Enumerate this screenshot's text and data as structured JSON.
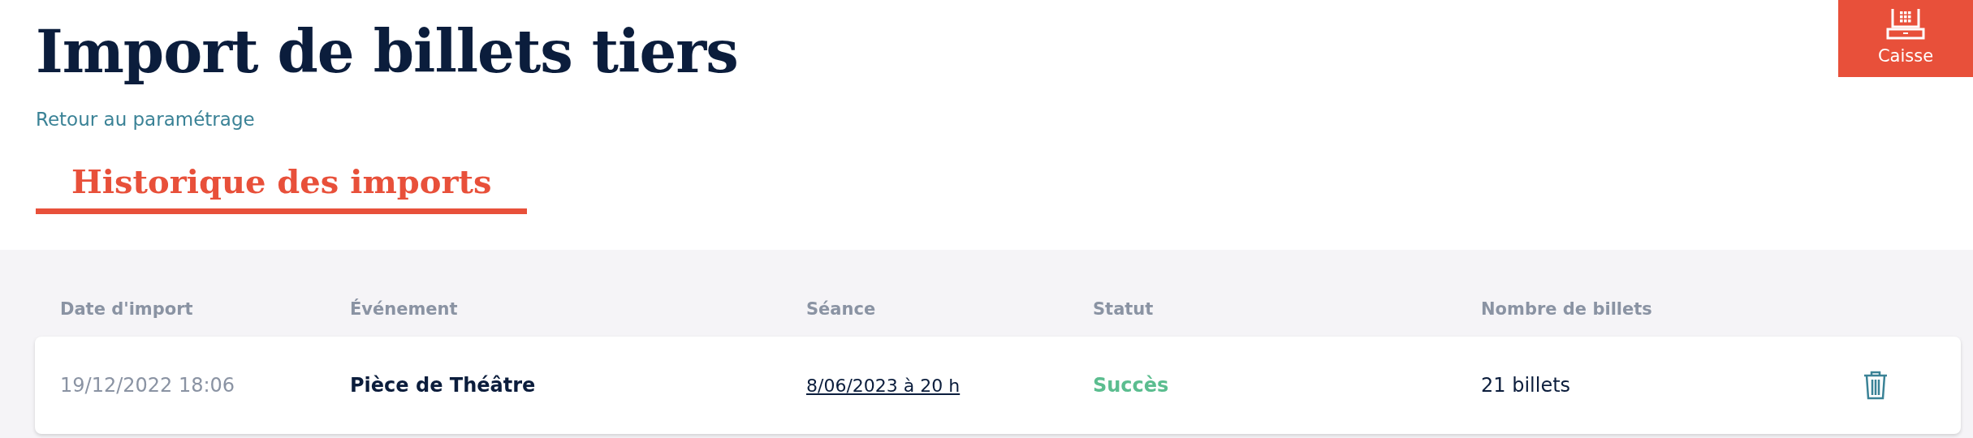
{
  "title": "Import de billets tiers",
  "back_link": "Retour au paramétrage",
  "cash_button": {
    "label": "Caisse"
  },
  "tabs": [
    {
      "label": "Historique des imports",
      "selected": true
    }
  ],
  "table": {
    "columns": [
      "Date d'import",
      "Événement",
      "Séance",
      "Statut",
      "Nombre de billets"
    ],
    "rows": [
      {
        "date": "19/12/2022 18:06",
        "event": "Pièce de Théâtre",
        "session": "8/06/2023 à 20 h",
        "status": {
          "text": "Succès",
          "kind": "success"
        },
        "tickets": "21 billets"
      }
    ]
  }
}
